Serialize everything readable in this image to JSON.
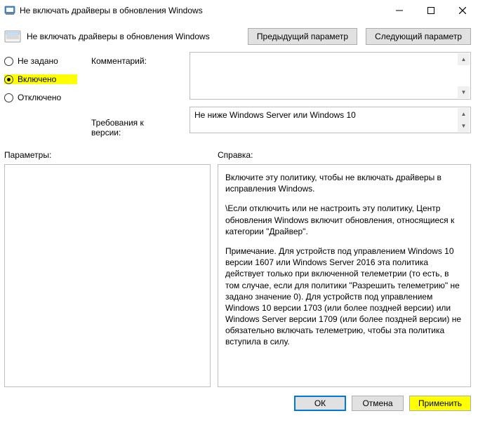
{
  "window": {
    "title": "Не включать драйверы в обновления Windows"
  },
  "subheader": {
    "title": "Не включать драйверы в обновления Windows"
  },
  "nav": {
    "prev": "Предыдущий параметр",
    "next": "Следующий параметр"
  },
  "radios": {
    "not_set": "Не задано",
    "enabled": "Включено",
    "disabled": "Отключено",
    "selected": "enabled"
  },
  "labels": {
    "comment": "Комментарий:",
    "version": "Требования к версии:",
    "params": "Параметры:",
    "help": "Справка:"
  },
  "version_text": "Не ниже Windows Server или Windows 10",
  "comment_text": "",
  "help_paragraphs": [
    "Включите эту политику, чтобы не включать драйверы в исправления Windows.",
    "\\Если отключить или не настроить эту политику, Центр обновления Windows включит обновления, относящиеся к категории \"Драйвер\".",
    "Примечание. Для устройств под управлением Windows 10 версии 1607 или Windows Server 2016 эта политика действует только при включенной телеметрии (то есть, в том случае, если для политики \"Разрешить телеметрию\" не задано значение 0). Для устройств под управлением Windows 10 версии 1703 (или более поздней версии) или Windows Server версии 1709 (или более поздней версии) не обязательно включать телеметрию, чтобы эта политика вступила в силу."
  ],
  "buttons": {
    "ok": "ОК",
    "cancel": "Отмена",
    "apply": "Применить"
  }
}
